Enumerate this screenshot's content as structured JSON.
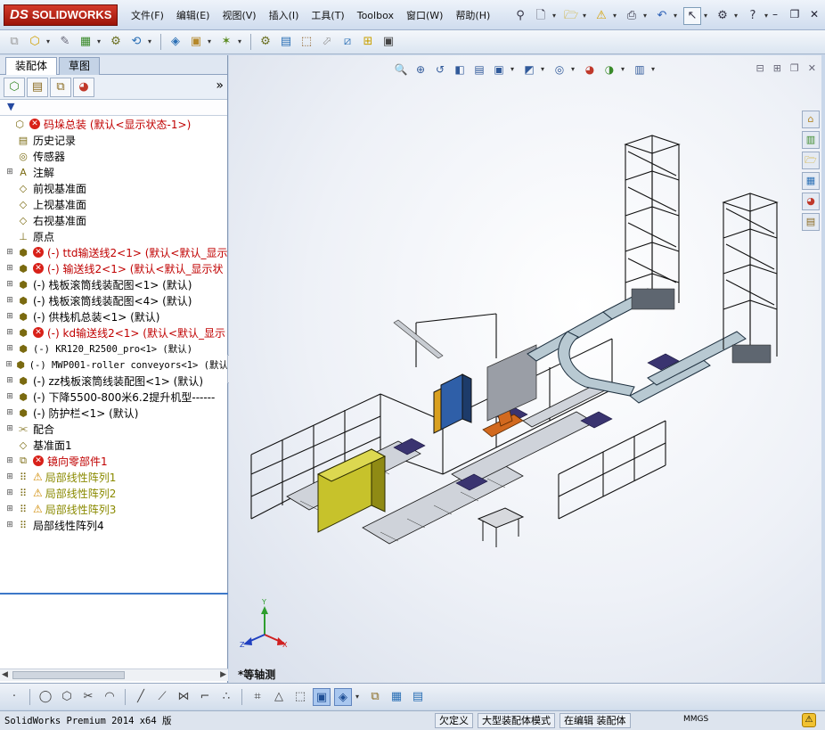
{
  "app": {
    "logo": "SOLIDWORKS",
    "logo_prefix": "DS"
  },
  "menu": [
    "文件(F)",
    "编辑(E)",
    "视图(V)",
    "插入(I)",
    "工具(T)",
    "Toolbox",
    "窗口(W)",
    "帮助(H)"
  ],
  "top_icons": [
    "pin-icon",
    "new-icon",
    "open-icon",
    "rebuild-warning-icon",
    "print-icon",
    "undo-icon",
    "select-icon",
    "options-icon",
    "help-icon"
  ],
  "window_controls": [
    "minimize-icon",
    "restore-icon",
    "close-icon"
  ],
  "manager": {
    "tabs": [
      "装配体",
      "草图"
    ],
    "panel_icons": [
      "featuremanager-icon",
      "propertymanager-icon",
      "configmanager-icon",
      "displaymanager-icon"
    ],
    "more": "»",
    "filter": "▼"
  },
  "tree": [
    {
      "label": "码垛总装  (默认<显示状态-1>)",
      "color": "red",
      "error": true,
      "level": 0,
      "icon": "assembly-icon"
    },
    {
      "label": "历史记录",
      "level": 1,
      "icon": "history-icon"
    },
    {
      "label": "传感器",
      "level": 1,
      "icon": "sensor-icon"
    },
    {
      "label": "注解",
      "level": 1,
      "icon": "annotation-icon",
      "expand": true
    },
    {
      "label": "前视基准面",
      "level": 1,
      "icon": "plane-icon"
    },
    {
      "label": "上视基准面",
      "level": 1,
      "icon": "plane-icon"
    },
    {
      "label": "右视基准面",
      "level": 1,
      "icon": "plane-icon"
    },
    {
      "label": "原点",
      "level": 1,
      "icon": "origin-icon"
    },
    {
      "label": "(-) ttd输送线2<1> (默认<默认_显示",
      "color": "red",
      "error": true,
      "level": 1,
      "icon": "subassembly-icon",
      "expand": true
    },
    {
      "label": "(-) 输送线2<1> (默认<默认_显示状",
      "color": "red",
      "error": true,
      "level": 1,
      "icon": "subassembly-icon",
      "expand": true
    },
    {
      "label": "(-) 栈板滚筒线装配图<1> (默认)",
      "level": 1,
      "icon": "subassembly-icon",
      "expand": true
    },
    {
      "label": "(-) 栈板滚筒线装配图<4> (默认)",
      "level": 1,
      "icon": "subassembly-icon",
      "expand": true
    },
    {
      "label": "(-) 供栈机总装<1> (默认)",
      "level": 1,
      "icon": "subassembly-icon",
      "expand": true
    },
    {
      "label": "(-) kd输送线2<1> (默认<默认_显示",
      "color": "red",
      "error": true,
      "level": 1,
      "icon": "subassembly-icon",
      "expand": true
    },
    {
      "label": "(-) KR120_R2500_pro<1> (默认)",
      "level": 1,
      "icon": "subassembly-icon",
      "expand": true,
      "mono": true
    },
    {
      "label": "(-) MWP001-roller conveyors<1> (默认",
      "level": 1,
      "icon": "subassembly-icon",
      "expand": true,
      "mono": true
    },
    {
      "label": "(-) zz栈板滚筒线装配图<1> (默认)",
      "level": 1,
      "icon": "subassembly-icon",
      "expand": true
    },
    {
      "label": "(-) 下降5500-800米6.2提升机型------",
      "level": 1,
      "icon": "subassembly-icon",
      "expand": true
    },
    {
      "label": "(-) 防护栏<1> (默认)",
      "level": 1,
      "icon": "subassembly-icon",
      "expand": true
    },
    {
      "label": "配合",
      "level": 1,
      "icon": "mates-icon",
      "expand": true
    },
    {
      "label": "基准面1",
      "level": 1,
      "icon": "plane-icon"
    },
    {
      "label": "镜向零部件1",
      "color": "red",
      "error": true,
      "level": 1,
      "icon": "mirror-icon",
      "expand": true
    },
    {
      "label": "局部线性阵列1",
      "color": "olive",
      "warning": true,
      "level": 1,
      "icon": "pattern-icon",
      "expand": true
    },
    {
      "label": "局部线性阵列2",
      "color": "olive",
      "warning": true,
      "level": 1,
      "icon": "pattern-icon",
      "expand": true
    },
    {
      "label": "局部线性阵列3",
      "color": "olive",
      "warning": true,
      "level": 1,
      "icon": "pattern-icon",
      "expand": true
    },
    {
      "label": "局部线性阵列4",
      "level": 1,
      "icon": "pattern-icon",
      "expand": true
    }
  ],
  "viewport": {
    "view_name": "*等轴测",
    "triad": {
      "x": "X",
      "y": "Y",
      "z": "Z"
    },
    "heads_up_icons": [
      "zoom-fit-icon",
      "zoom-area-icon",
      "previous-view-icon",
      "section-view-icon",
      "dynamic-annotation-icon",
      "view-orientation-icon",
      "display-style-icon",
      "hide-show-icon",
      "edit-appearance-icon",
      "apply-scene-icon",
      "view-settings-icon"
    ],
    "task_pane_icons": [
      "home-icon",
      "design-library-icon",
      "file-explorer-icon",
      "view-palette-icon",
      "appearances-icon",
      "custom-properties-icon"
    ]
  },
  "viewbar_icons": [
    "point-icon",
    "circle-icon",
    "polygon-icon",
    "trim-icon",
    "arc-icon",
    "line-icon",
    "corner-icon",
    "mirror-icon",
    "fillet-icon",
    "chamfer-icon",
    "mesh-icon",
    "triangle-icon",
    "cube-icon",
    "box-shaded-icon",
    "shaded-icon",
    "section-icon",
    "palette-icon",
    "frame-icon"
  ],
  "status": {
    "app": "SolidWorks Premium 2014 x64 版",
    "underdefined": "欠定义",
    "large_assembly": "大型装配体模式",
    "editing": "在编辑 装配体",
    "units": "MMGS"
  },
  "colors": {
    "error": "#d82018",
    "tree_red": "#c00000",
    "tree_olive": "#8a8a00",
    "accent_blue": "#3d78c8"
  }
}
